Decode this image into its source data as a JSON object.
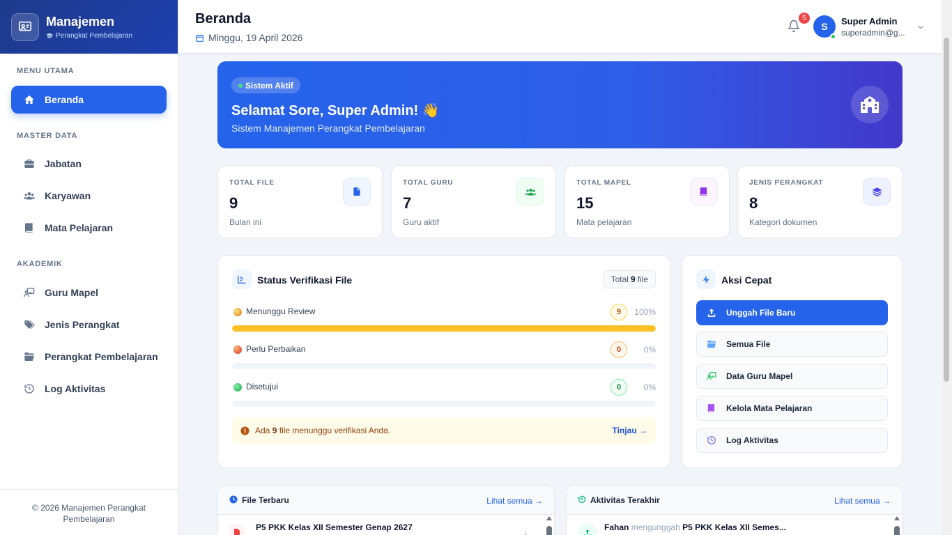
{
  "sidebar": {
    "brand_title": "Manajemen",
    "brand_sub": "Perangkat Pembelajaran",
    "sections": {
      "main": "MENU UTAMA",
      "master": "MASTER DATA",
      "academic": "AKADEMIK"
    },
    "items": [
      {
        "label": "Beranda",
        "icon": "home-icon"
      },
      {
        "label": "Jabatan",
        "icon": "briefcase-icon"
      },
      {
        "label": "Karyawan",
        "icon": "users-icon"
      },
      {
        "label": "Mata Pelajaran",
        "icon": "book-icon"
      },
      {
        "label": "Guru Mapel",
        "icon": "teacher-icon"
      },
      {
        "label": "Jenis Perangkat",
        "icon": "tags-icon"
      },
      {
        "label": "Perangkat Pembelajaran",
        "icon": "folder-icon"
      },
      {
        "label": "Log Aktivitas",
        "icon": "history-icon"
      }
    ],
    "footer": "© 2026 Manajemen Perangkat Pembelajaran"
  },
  "header": {
    "title": "Beranda",
    "date": "Minggu, 19 April 2026",
    "notifications": "5",
    "avatar_initial": "S",
    "user_name": "Super Admin",
    "user_email": "superadmin@g..."
  },
  "hero": {
    "badge": "Sistem Aktif",
    "greeting": "Selamat Sore, Super Admin! 👋",
    "subtitle": "Sistem Manajemen Perangkat Pembelajaran"
  },
  "stats": [
    {
      "label": "TOTAL FILE",
      "value": "9",
      "note": "Bulan ini",
      "icon": "file-icon",
      "color": "#2563eb",
      "bg": "#eff6ff"
    },
    {
      "label": "TOTAL GURU",
      "value": "7",
      "note": "Guru aktif",
      "icon": "users-icon",
      "color": "#16a34a",
      "bg": "#f0fdf4"
    },
    {
      "label": "TOTAL MAPEL",
      "value": "15",
      "note": "Mata pelajaran",
      "icon": "book-icon",
      "color": "#9333ea",
      "bg": "#faf5ff"
    },
    {
      "label": "JENIS PERANGKAT",
      "value": "8",
      "note": "Kategori dokumen",
      "icon": "layers-icon",
      "color": "#4f46e5",
      "bg": "#eef2ff"
    }
  ],
  "verification": {
    "title": "Status Verifikasi File",
    "total_prefix": "Total",
    "total_value": "9",
    "total_suffix": "file",
    "rows": [
      {
        "label": "Menunggu Review",
        "count": "9",
        "percent": "100%",
        "fraction": 1.0,
        "color": "#fbbf24",
        "border": "#fcd34d",
        "text": "#b45309",
        "bg": "#fffbeb"
      },
      {
        "label": "Perlu Perbaikan",
        "count": "0",
        "percent": "0%",
        "fraction": 0,
        "color": "#ef4444",
        "border": "#fdba74",
        "text": "#c2410c",
        "bg": "#fff7ed"
      },
      {
        "label": "Disetujui",
        "count": "0",
        "percent": "0%",
        "fraction": 0,
        "color": "#22c55e",
        "border": "#86efac",
        "text": "#15803d",
        "bg": "#f0fdf4"
      }
    ],
    "alert_prefix": "Ada",
    "alert_count": "9",
    "alert_suffix": "file menunggu verifikasi Anda.",
    "alert_link": "Tinjau →"
  },
  "quick_actions": {
    "title": "Aksi Cepat",
    "items": [
      {
        "label": "Unggah File Baru",
        "icon": "upload-icon"
      },
      {
        "label": "Semua File",
        "icon": "folder-open-icon"
      },
      {
        "label": "Data Guru Mapel",
        "icon": "teacher-icon"
      },
      {
        "label": "Kelola Mata Pelajaran",
        "icon": "book-icon"
      },
      {
        "label": "Log Aktivitas",
        "icon": "history-icon"
      }
    ]
  },
  "recent_files": {
    "title": "File Terbaru",
    "see_all": "Lihat semua →",
    "first_item": "P5 PKK Kelas XII Semester Genap 2627"
  },
  "recent_activity": {
    "title": "Aktivitas Terakhir",
    "see_all": "Lihat semua →",
    "first_actor": "Fahan",
    "first_action": "mengunggah",
    "first_target": "P5 PKK Kelas XII Semes..."
  }
}
